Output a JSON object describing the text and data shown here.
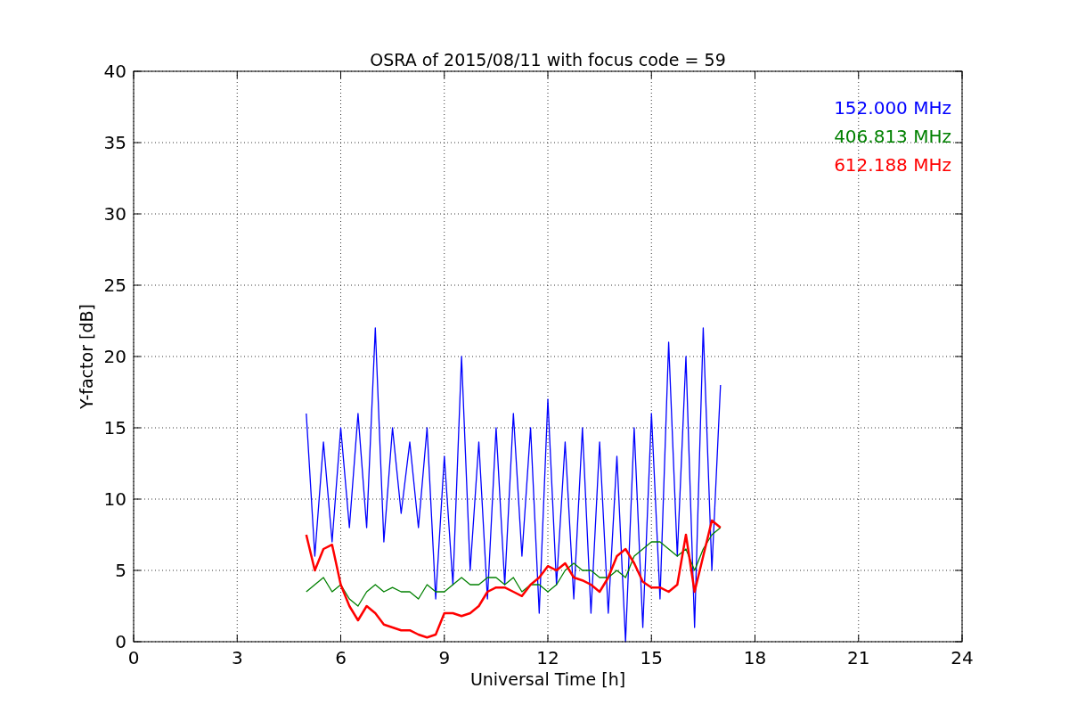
{
  "chart_data": {
    "type": "line",
    "title": "OSRA of 2015/08/11 with focus code = 59",
    "xlabel": "Universal Time [h]",
    "ylabel": "Y-factor [dB]",
    "x": [
      5,
      5.25,
      5.5,
      5.75,
      6,
      6.25,
      6.5,
      6.75,
      7,
      7.25,
      7.5,
      7.75,
      8,
      8.25,
      8.5,
      8.75,
      9,
      9.25,
      9.5,
      9.75,
      10,
      10.25,
      10.5,
      10.75,
      11,
      11.25,
      11.5,
      11.75,
      12,
      12.25,
      12.5,
      12.75,
      13,
      13.25,
      13.5,
      13.75,
      14,
      14.25,
      14.5,
      14.75,
      15,
      15.25,
      15.5,
      15.75,
      16,
      16.25,
      16.5,
      16.75,
      17
    ],
    "series": [
      {
        "name": "152.000 MHz",
        "color": "#0000ff",
        "values": [
          16,
          6,
          14,
          7,
          15,
          8,
          16,
          8,
          22,
          7,
          15,
          9,
          14,
          8,
          15,
          3,
          13,
          4,
          20,
          5,
          14,
          3,
          15,
          4,
          16,
          6,
          15,
          2,
          17,
          4,
          14,
          3,
          15,
          2,
          14,
          2,
          13,
          0,
          15,
          1,
          16,
          3,
          21,
          6,
          20,
          1,
          22,
          5,
          18
        ]
      },
      {
        "name": "406.813 MHz",
        "color": "#008000",
        "values": [
          3.5,
          4,
          4.5,
          3.5,
          4,
          3,
          2.5,
          3.5,
          4,
          3.5,
          3.8,
          3.5,
          3.5,
          3,
          4,
          3.5,
          3.5,
          4,
          4.5,
          4,
          4,
          4.5,
          4.5,
          4,
          4.5,
          3.5,
          4,
          4,
          3.5,
          4,
          5,
          5.5,
          5,
          5,
          4.5,
          4.5,
          5,
          4.5,
          6,
          6.5,
          7,
          7,
          6.5,
          6,
          6.5,
          5,
          6.5,
          7.5,
          8
        ]
      },
      {
        "name": "612.188 MHz",
        "color": "#ff0000",
        "values": [
          7.5,
          5,
          6.5,
          6.8,
          4,
          2.5,
          1.5,
          2.5,
          2,
          1.2,
          1,
          0.8,
          0.8,
          0.5,
          0.3,
          0.5,
          2,
          2,
          1.8,
          2,
          2.5,
          3.5,
          3.8,
          3.8,
          3.5,
          3.2,
          4,
          4.5,
          5.3,
          5,
          5.5,
          4.5,
          4.3,
          4,
          3.5,
          4.5,
          6,
          6.5,
          5.5,
          4.2,
          3.8,
          3.8,
          3.5,
          4,
          7.5,
          3.5,
          6,
          8.5,
          8
        ]
      }
    ],
    "xlim": [
      0,
      24
    ],
    "ylim": [
      0,
      40
    ],
    "xticks": [
      0,
      3,
      6,
      9,
      12,
      15,
      18,
      21,
      24
    ],
    "yticks": [
      0,
      5,
      10,
      15,
      20,
      25,
      30,
      35,
      40
    ],
    "grid": true
  }
}
